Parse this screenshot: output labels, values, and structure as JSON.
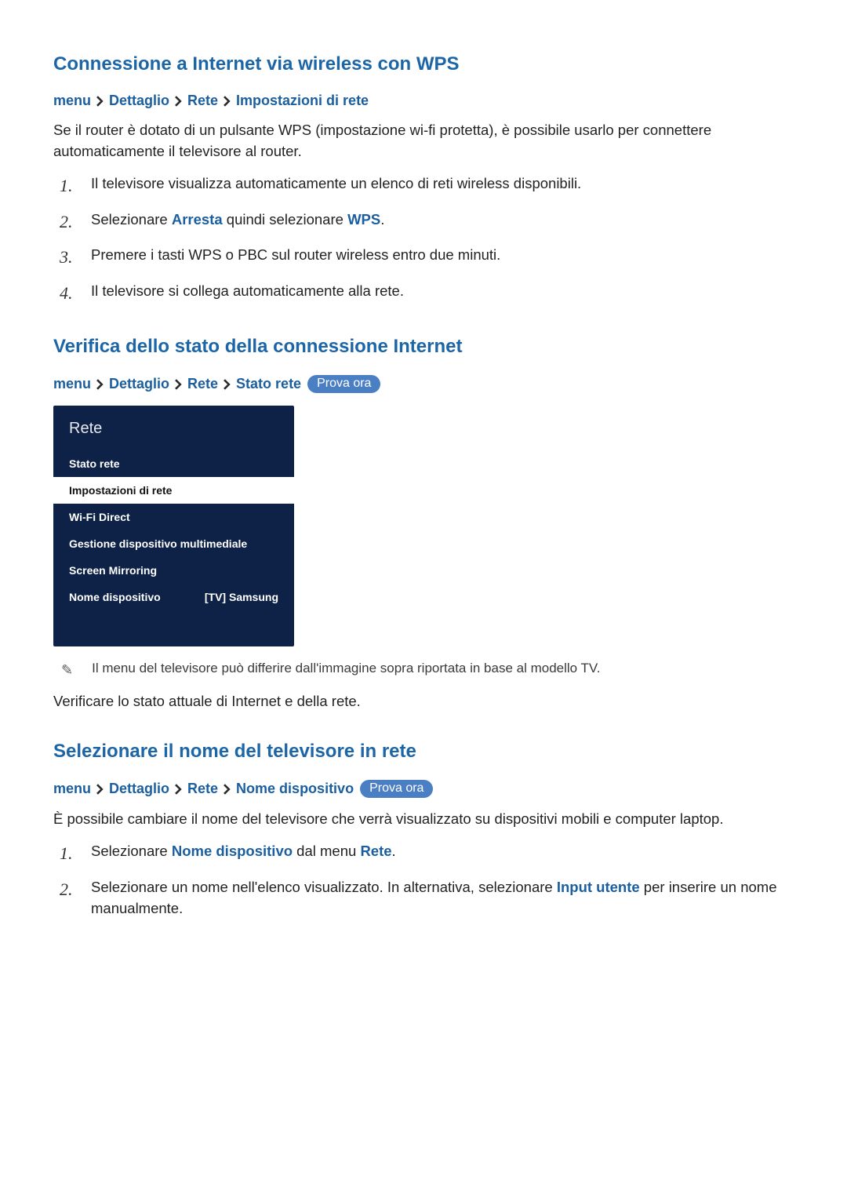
{
  "sections": [
    {
      "heading": "Connessione a Internet via wireless con WPS",
      "crumbs": [
        "menu",
        "Dettaglio",
        "Rete",
        "Impostazioni di rete"
      ],
      "badge": null,
      "intro": "Se il router è dotato di un pulsante WPS (impostazione wi-fi protetta), è possibile usarlo per connettere automaticamente il televisore al router.",
      "steps": [
        {
          "n": "1.",
          "text": "Il televisore visualizza automaticamente un elenco di reti wireless disponibili."
        },
        {
          "n": "2.",
          "pre": "Selezionare ",
          "em1": "Arresta",
          "mid": " quindi selezionare ",
          "em2": "WPS",
          "post": "."
        },
        {
          "n": "3.",
          "text": "Premere i tasti WPS o PBC sul router wireless entro due minuti."
        },
        {
          "n": "4.",
          "text": "Il televisore si collega automaticamente alla rete."
        }
      ]
    },
    {
      "heading": "Verifica dello stato della connessione Internet",
      "crumbs": [
        "menu",
        "Dettaglio",
        "Rete",
        "Stato rete"
      ],
      "badge": "Prova ora",
      "panel": {
        "title": "Rete",
        "rows": [
          {
            "label": "Stato rete",
            "selected": false
          },
          {
            "label": "Impostazioni di rete",
            "selected": true
          },
          {
            "label": "Wi-Fi Direct",
            "selected": false
          },
          {
            "label": "Gestione dispositivo multimediale",
            "selected": false
          },
          {
            "label": "Screen Mirroring",
            "selected": false
          },
          {
            "label": "Nome dispositivo",
            "right": "[TV] Samsung",
            "selected": false
          }
        ]
      },
      "note": "Il menu del televisore può differire dall'immagine sopra riportata in base al modello TV.",
      "after": "Verificare lo stato attuale di Internet e della rete."
    },
    {
      "heading": "Selezionare il nome del televisore in rete",
      "crumbs": [
        "menu",
        "Dettaglio",
        "Rete",
        "Nome dispositivo"
      ],
      "badge": "Prova ora",
      "intro": "È possibile cambiare il nome del televisore che verrà visualizzato su dispositivi mobili e computer laptop.",
      "steps": [
        {
          "n": "1.",
          "pre": "Selezionare ",
          "em1": "Nome dispositivo",
          "mid": " dal menu ",
          "em2": "Rete",
          "post": "."
        },
        {
          "n": "2.",
          "pre": "Selezionare un nome nell'elenco visualizzato. In alternativa, selezionare ",
          "em1": "Input utente",
          "mid": "",
          "em2": "",
          "post": " per inserire un nome manualmente."
        }
      ]
    }
  ]
}
